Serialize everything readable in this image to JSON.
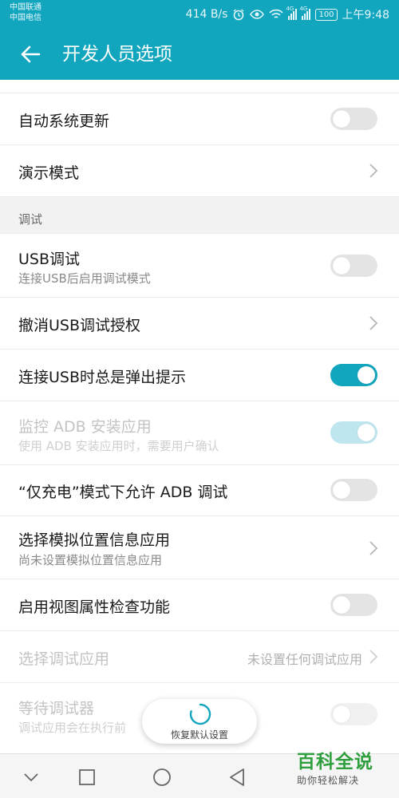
{
  "status_bar": {
    "carrier_1": "中国联通",
    "carrier_2": "中国电信",
    "network_speed": "414 B/s",
    "sig1_tag": "4G",
    "sig2_tag": "4G",
    "battery": "100",
    "time": "上午9:48"
  },
  "app_bar": {
    "title": "开发人员选项",
    "color": "#12a5be"
  },
  "settings": {
    "auto_update": {
      "title": "自动系统更新",
      "enabled": false
    },
    "demo_mode": {
      "title": "演示模式"
    },
    "debug_section": "调试",
    "usb_debug": {
      "title": "USB调试",
      "subtitle": "连接USB后启用调试模式",
      "enabled": false
    },
    "revoke_usb": {
      "title": "撤消USB调试授权"
    },
    "usb_prompt": {
      "title": "连接USB时总是弹出提示",
      "enabled": true
    },
    "adb_install": {
      "title": "监控 ADB 安装应用",
      "subtitle": "使用 ADB 安装应用时，需要用户确认",
      "enabled": true,
      "disabled_row": true
    },
    "charge_only_adb": {
      "title": "“仅充电”模式下允许 ADB 调试",
      "enabled": false
    },
    "mock_location": {
      "title": "选择模拟位置信息应用",
      "subtitle": "尚未设置模拟位置信息应用"
    },
    "view_attr": {
      "title": "启用视图属性检查功能",
      "enabled": false
    },
    "debug_app": {
      "title": "选择调试应用",
      "value": "未设置任何调试应用",
      "disabled_row": true
    },
    "wait_debugger": {
      "title": "等待调试器",
      "subtitle": "调试应用会在执行前",
      "enabled": false,
      "disabled_row": true
    }
  },
  "reset": {
    "label": "恢复默认设置"
  },
  "watermark": {
    "brand": "百科全说",
    "slogan": "助你轻松解决"
  },
  "icons": {
    "back": "back-arrow-icon",
    "chevron": "chevron-right-icon",
    "nav_down": "chevron-down-icon",
    "nav_recent": "square-icon",
    "nav_home": "circle-icon",
    "nav_back": "triangle-back-icon"
  }
}
